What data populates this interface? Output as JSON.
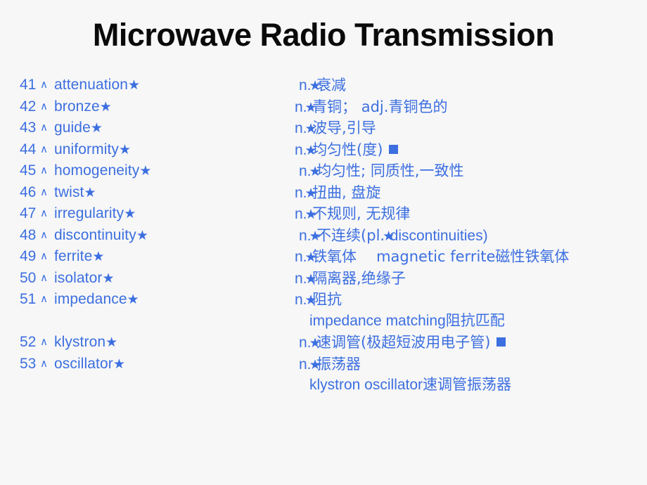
{
  "slide": {
    "title": "Microwave Radio Transmission",
    "accent_color": "#3c6fe0",
    "title_color": "#0a0a0a",
    "background_color": "#f7f7f7",
    "caret_icon": "∧",
    "star_icon": "★",
    "square_icon": "■"
  },
  "entries": [
    {
      "num": "41",
      "word": "attenuation",
      "pos": "n.",
      "definition": "衰减",
      "indent": 1,
      "has_square": false
    },
    {
      "num": "42",
      "word": "bronze",
      "pos": "n.",
      "definition": "青铜； adj.青铜色的",
      "indent": 0,
      "has_square": false
    },
    {
      "num": "43",
      "word": "guide",
      "pos": "n.",
      "definition": "波导,引导",
      "indent": 0,
      "has_square": false
    },
    {
      "num": "44",
      "word": "uniformity",
      "pos": "n.",
      "definition": "均匀性(度)",
      "indent": 0,
      "has_square": true
    },
    {
      "num": "45",
      "word": "homogeneity",
      "pos": "n.",
      "definition": "均匀性; 同质性,一致性",
      "indent": 1,
      "has_square": false
    },
    {
      "num": "46",
      "word": "twist",
      "pos": "n.",
      "definition": "扭曲, 盘旋",
      "indent": 0,
      "has_square": false
    },
    {
      "num": "47",
      "word": "irregularity",
      "pos": "n.",
      "definition": "不规则, 无规律",
      "indent": 0,
      "has_square": false
    },
    {
      "num": "48",
      "word": "discontinuity",
      "pos": "n.",
      "definition": "不连续(pl.",
      "definition_tail": "discontinuities)",
      "indent": 1,
      "has_square": false
    },
    {
      "num": "49",
      "word": "ferrite",
      "pos": "n.",
      "definition": "铁氧体",
      "example": "magnetic ferrite磁性铁氧体",
      "indent": 0,
      "has_square": false
    },
    {
      "num": "50",
      "word": "isolator",
      "pos": "n.",
      "definition": "隔离器,绝缘子",
      "indent": 0,
      "has_square": false
    },
    {
      "num": "51",
      "word": "impedance",
      "pos": "n.",
      "definition": "阻抗",
      "indent": 0,
      "has_square": false
    },
    {
      "num": "",
      "word": "",
      "pos": "",
      "definition": "",
      "phrase": "impedance matching阻抗匹配",
      "indent": 2,
      "has_square": false
    },
    {
      "num": "52",
      "word": "klystron",
      "pos": "n.",
      "definition": "速调管(极超短波用电子管)",
      "indent": 1,
      "has_square": true
    },
    {
      "num": "53",
      "word": "oscillator",
      "pos": "n.",
      "definition": "振荡器",
      "indent": 1,
      "has_square": false
    },
    {
      "num": "",
      "word": "",
      "pos": "",
      "definition": "",
      "phrase": "klystron oscillator速调管振荡器",
      "indent": 2,
      "has_square": false
    }
  ]
}
